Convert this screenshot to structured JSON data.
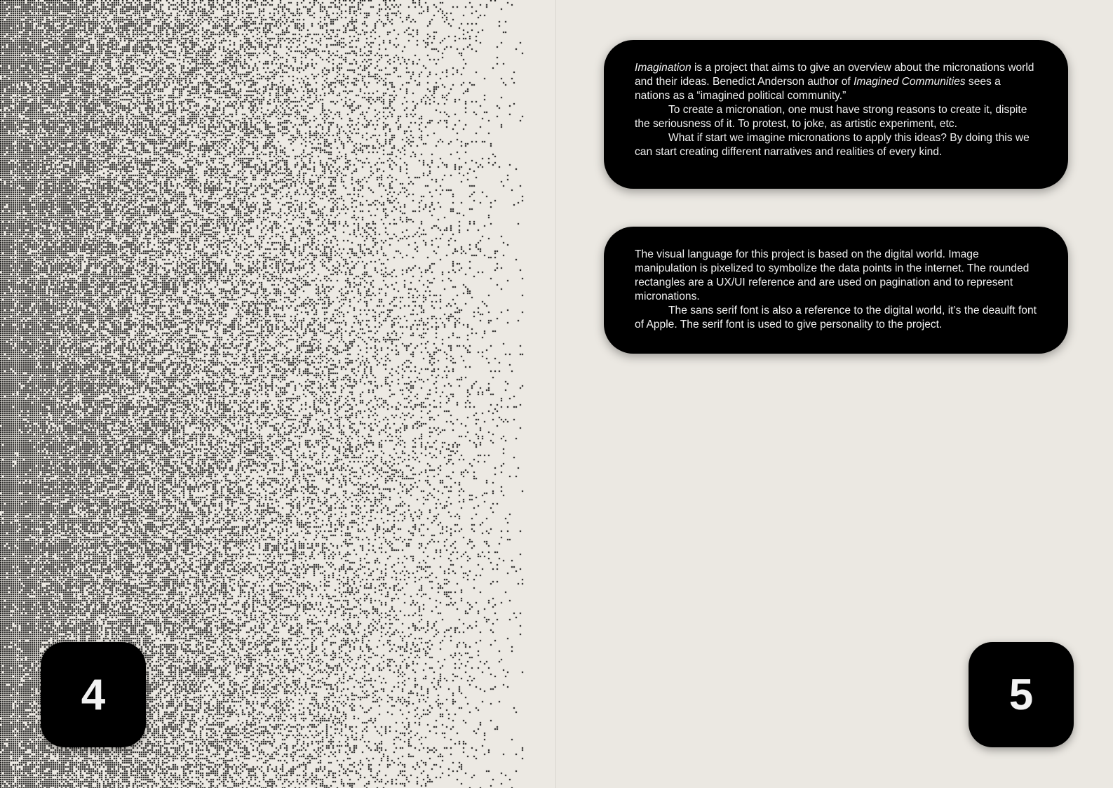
{
  "left_page": {
    "page_number": "4"
  },
  "right_page": {
    "page_number": "5",
    "intro": {
      "title_word": "Imagination",
      "p1_part1": " is a project that aims to give an overview about the micronations world and their ideas. Benedict Anderson author of ",
      "book_title": "Imagined Communities",
      "p1_part2": " sees a nations as a “imagined political community.”",
      "p2": "To create a micronation, one must have strong reasons to create it, dispite the seriousness of it. To protest, to joke, as artistic experiment, etc.",
      "p3": "What if start we imagine micronations to apply this ideas? By doing this we can start creating different narratives and realities of every kind."
    },
    "visual_language": {
      "p1": "The visual language for this project is based on the digital world. Image manipulation is pixelized to symbolize the data points in the internet. The rounded rectangles are a UX/UI reference and are used on pagination and to represent micronations.",
      "p2": "The sans serif font is also a reference to the digital world, it’s the deaulft font of Apple. The serif font is used to give personality to the project."
    }
  },
  "colors": {
    "paper": "#ebe8e2",
    "ink": "#000000",
    "card_text": "#f2f2f2"
  }
}
